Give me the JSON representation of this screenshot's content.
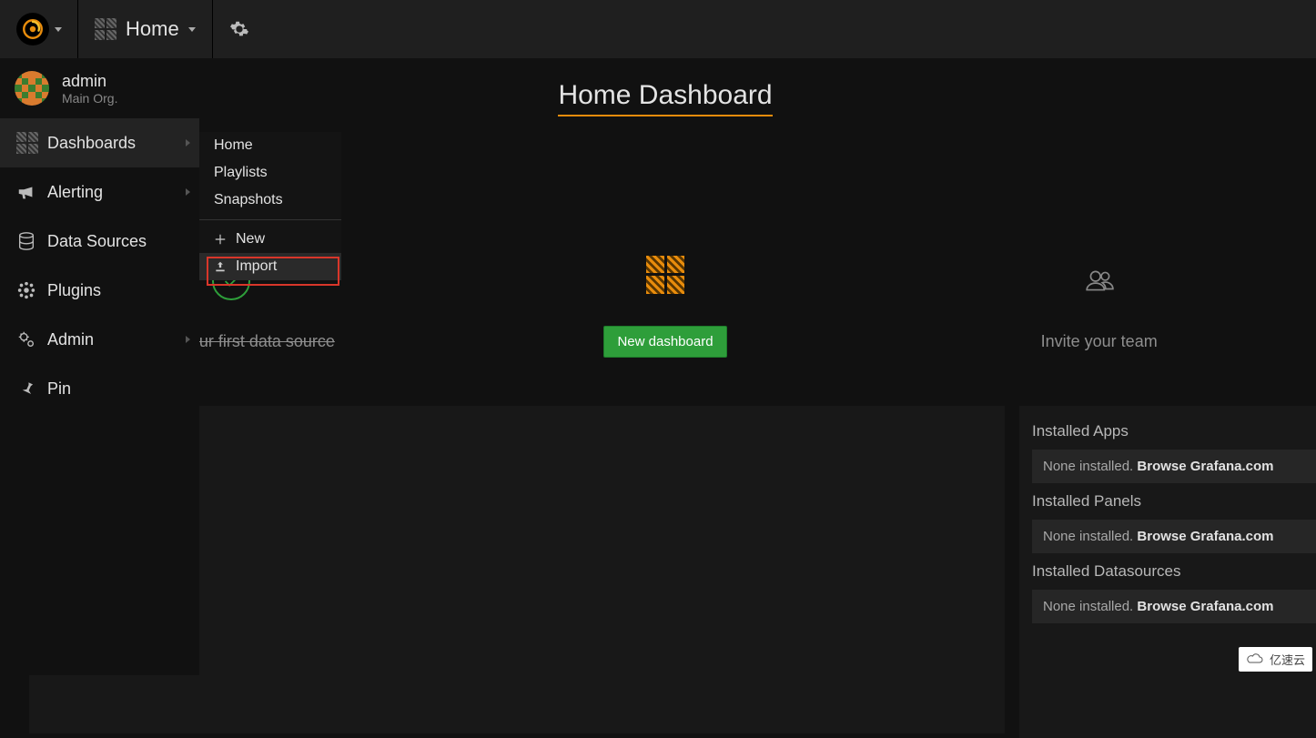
{
  "topbar": {
    "home_label": "Home"
  },
  "user": {
    "name": "admin",
    "org": "Main Org."
  },
  "sidebar": {
    "items": [
      {
        "label": "Dashboards",
        "active": true,
        "chev": true
      },
      {
        "label": "Alerting",
        "chev": true
      },
      {
        "label": "Data Sources"
      },
      {
        "label": "Plugins"
      },
      {
        "label": "Admin",
        "chev": true
      },
      {
        "label": "Pin"
      }
    ]
  },
  "submenu": {
    "items_top": [
      {
        "label": "Home"
      },
      {
        "label": "Playlists"
      },
      {
        "label": "Snapshots"
      }
    ],
    "items_bottom": [
      {
        "label": "New",
        "icon": "plus"
      },
      {
        "label": "Import",
        "icon": "upload",
        "highlight": true
      }
    ]
  },
  "main": {
    "title": "Home Dashboard",
    "cards": [
      {
        "label": "Create your first data source",
        "type": "done"
      },
      {
        "label": "New dashboard",
        "type": "button"
      },
      {
        "label": "Invite your team",
        "type": "people"
      }
    ]
  },
  "right_panel": {
    "sections": [
      {
        "head": "Installed Apps",
        "text": "None installed. ",
        "link": "Browse Grafana.com"
      },
      {
        "head": "Installed Panels",
        "text": "None installed. ",
        "link": "Browse Grafana.com"
      },
      {
        "head": "Installed Datasources",
        "text": "None installed. ",
        "link": "Browse Grafana.com"
      }
    ]
  },
  "watermark": "亿速云"
}
